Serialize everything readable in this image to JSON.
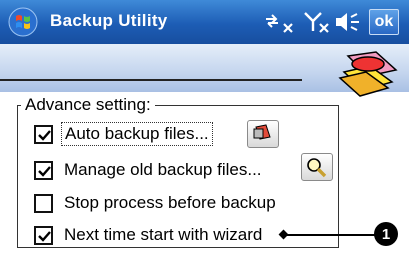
{
  "titlebar": {
    "title": "Backup Utility",
    "ok_label": "ok",
    "icons": [
      "start-icon",
      "sync-icon",
      "signal-icon",
      "volume-icon"
    ]
  },
  "group": {
    "legend": "Advance setting:",
    "options": [
      {
        "label": "Auto backup files...",
        "checked": true
      },
      {
        "label": "Manage old backup files...",
        "checked": true
      },
      {
        "label": "Stop process before backup",
        "checked": false
      },
      {
        "label": "Next time start with wizard",
        "checked": true
      }
    ]
  },
  "callout": {
    "number": "1"
  },
  "colors": {
    "titlebar": "#1d5db5",
    "band": "#c4d5ee",
    "callout": "#000000"
  }
}
